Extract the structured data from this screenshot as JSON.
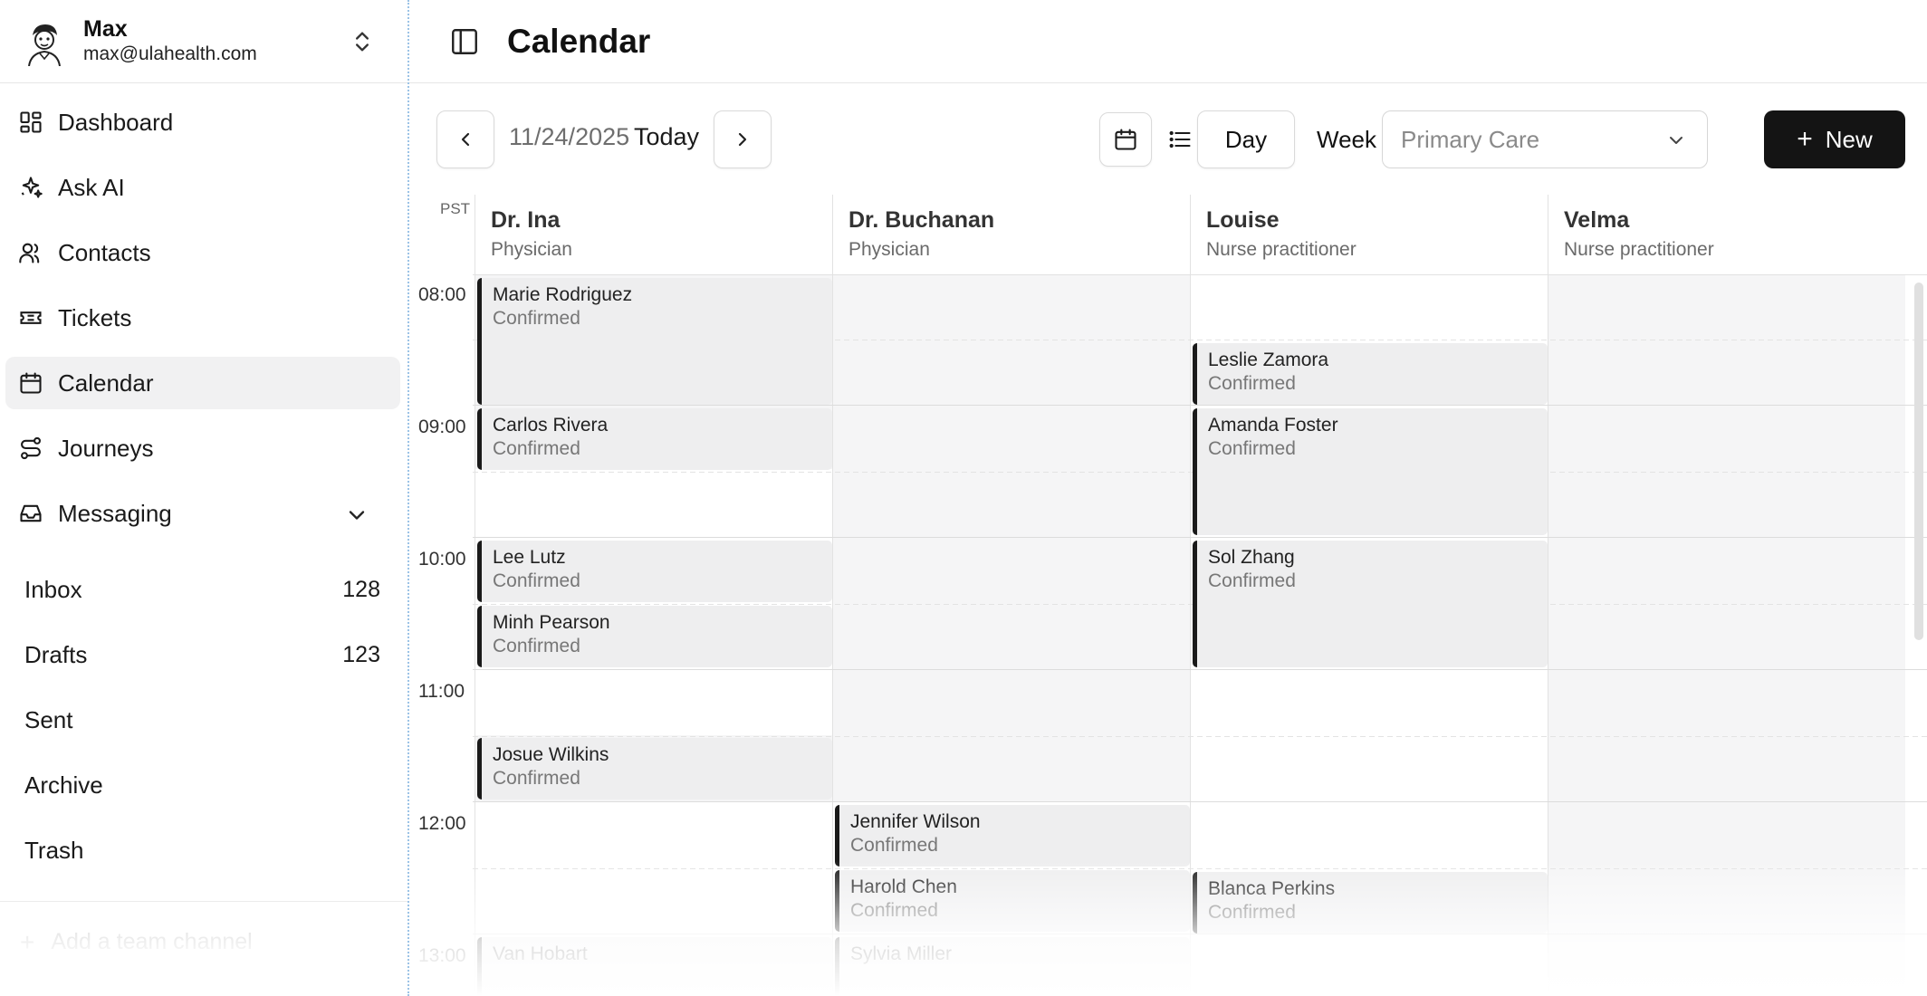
{
  "user": {
    "name": "Max",
    "email": "max@ulahealth.com"
  },
  "nav": {
    "dashboard": "Dashboard",
    "ask_ai": "Ask AI",
    "contacts": "Contacts",
    "tickets": "Tickets",
    "calendar": "Calendar",
    "journeys": "Journeys",
    "messaging": "Messaging"
  },
  "inbox": {
    "inbox_label": "Inbox",
    "inbox_count": "128",
    "drafts_label": "Drafts",
    "drafts_count": "123",
    "sent_label": "Sent",
    "archive_label": "Archive",
    "trash_label": "Trash"
  },
  "add_channel": "Add a team channel",
  "page_title": "Calendar",
  "toolbar": {
    "date": "11/24/2025",
    "today": "Today",
    "day": "Day",
    "week": "Week",
    "department": "Primary Care",
    "new": "New"
  },
  "timezone": "PST",
  "times": [
    "08:00",
    "09:00",
    "10:00",
    "11:00",
    "12:00",
    "13:00"
  ],
  "providers": [
    {
      "name": "Dr. Ina",
      "role": "Physician"
    },
    {
      "name": "Dr. Buchanan",
      "role": "Physician"
    },
    {
      "name": "Louise",
      "role": "Nurse practitioner"
    },
    {
      "name": "Velma",
      "role": "Nurse practitioner"
    }
  ],
  "events": [
    {
      "patient": "Marie Rodriguez",
      "status": "Confirmed"
    },
    {
      "patient": "Carlos Rivera",
      "status": "Confirmed"
    },
    {
      "patient": "Lee Lutz",
      "status": "Confirmed"
    },
    {
      "patient": "Minh Pearson",
      "status": "Confirmed"
    },
    {
      "patient": "Josue Wilkins",
      "status": "Confirmed"
    },
    {
      "patient": "Leslie Zamora",
      "status": "Confirmed"
    },
    {
      "patient": "Amanda Foster",
      "status": "Confirmed"
    },
    {
      "patient": "Sol Zhang",
      "status": "Confirmed"
    },
    {
      "patient": "Jennifer Wilson",
      "status": "Confirmed"
    },
    {
      "patient": "Harold Chen",
      "status": "Confirmed"
    },
    {
      "patient": "Blanca Perkins",
      "status": "Confirmed"
    },
    {
      "patient": "Van Hobart",
      "status": ""
    },
    {
      "patient": "Sylvia Miller",
      "status": ""
    }
  ]
}
